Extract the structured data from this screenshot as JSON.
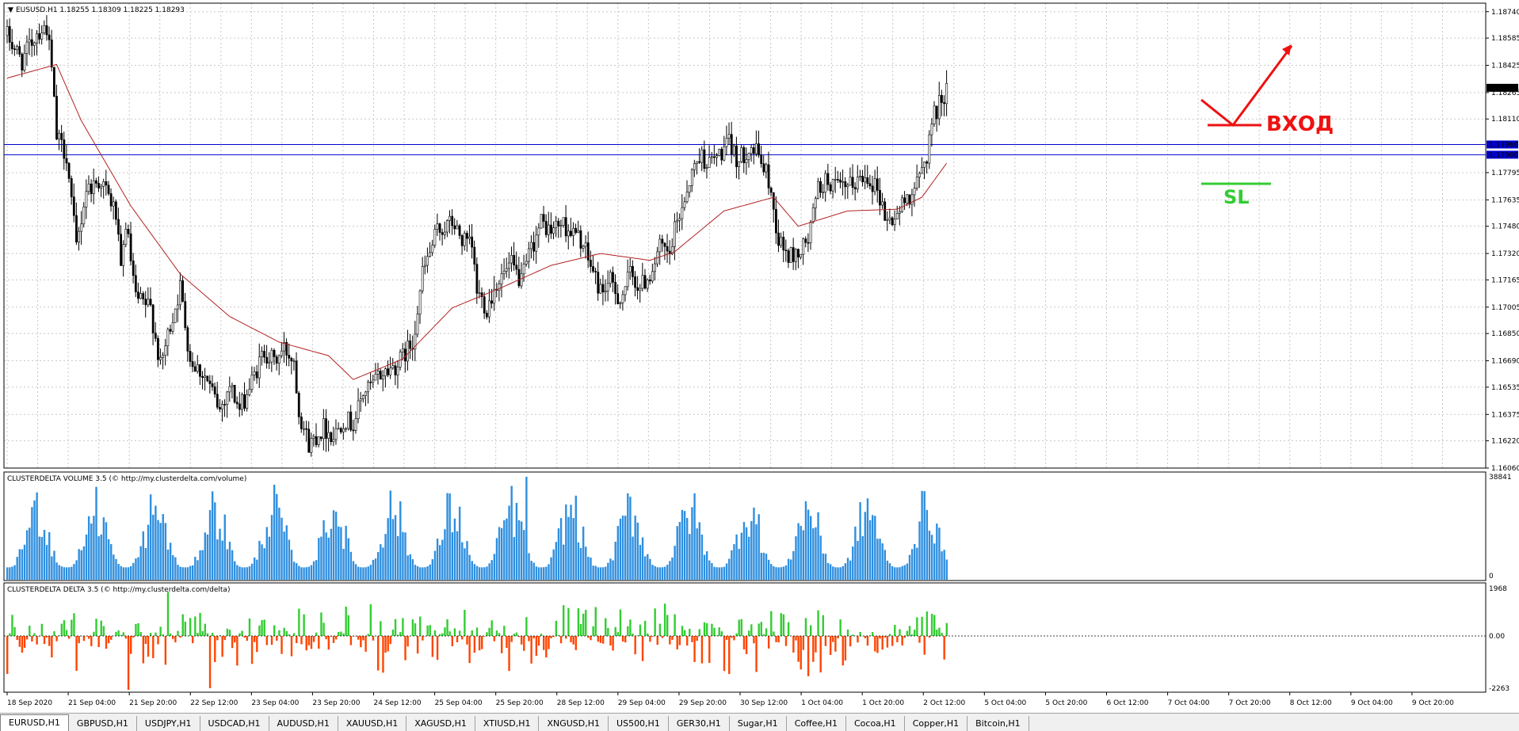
{
  "colors": {
    "candle": "#000000",
    "ma": "#b22222",
    "hline": "#0000cd",
    "volume_bar": "#2f8fdf",
    "delta_positive": "#32cd32",
    "delta_negative": "#ff4500",
    "annotation_red": "#ee1111",
    "annotation_green": "#33cc33",
    "grid": "#c8c8c8",
    "price_tag_bg": "#000000"
  },
  "main_panel": {
    "title": "EUSUSD.H1  1.18255 1.18309 1.18225 1.18293",
    "collapse_icon": "triangle-down-icon",
    "price_ticks": [
      "1.18740",
      "1.18585",
      "1.18425",
      "1.18265",
      "1.18110",
      "1.17795",
      "1.17635",
      "1.17480",
      "1.17320",
      "1.17165",
      "1.17005",
      "1.16850",
      "1.16690",
      "1.16535",
      "1.16375",
      "1.16220",
      "1.16060"
    ],
    "current_price": "1.18293",
    "levels": [
      "1.17960",
      "1.17900"
    ],
    "annotations": {
      "entry": "ВХОД",
      "stop": "SL"
    }
  },
  "volume_panel": {
    "title": "CLUSTERDELTA VOLUME 3.5 (© http://my.clusterdelta.com/volume)",
    "ticks": [
      "38841",
      "0"
    ]
  },
  "delta_panel": {
    "title": "CLUSTERDELTA DELTA 3.5 (© http://my.clusterdelta.com/delta)",
    "ticks": [
      "1968",
      "0.00",
      "-2263"
    ]
  },
  "time_axis": [
    "18 Sep 2020",
    "21 Sep 04:00",
    "21 Sep 20:00",
    "22 Sep 12:00",
    "23 Sep 04:00",
    "23 Sep 20:00",
    "24 Sep 12:00",
    "25 Sep 04:00",
    "25 Sep 20:00",
    "28 Sep 12:00",
    "29 Sep 04:00",
    "29 Sep 20:00",
    "30 Sep 12:00",
    "1 Oct 04:00",
    "1 Oct 20:00",
    "2 Oct 12:00",
    "5 Oct 04:00",
    "5 Oct 20:00",
    "6 Oct 12:00",
    "7 Oct 04:00",
    "7 Oct 20:00",
    "8 Oct 12:00",
    "9 Oct 04:00",
    "9 Oct 20:00"
  ],
  "tabs": [
    "EURUSD,H1",
    "GBPUSD,H1",
    "USDJPY,H1",
    "USDCAD,H1",
    "AUDUSD,H1",
    "XAUUSD,H1",
    "XAGUSD,H1",
    "XTIUSD,H1",
    "XNGUSD,H1",
    "US500,H1",
    "GER30,H1",
    "Sugar,H1",
    "Coffee,H1",
    "Cocoa,H1",
    "Copper,H1",
    "Bitcoin,H1"
  ],
  "chart_data": {
    "type": "candlestick",
    "symbol": "EURUSD",
    "timeframe": "H1",
    "ylim": [
      1.1606,
      1.1879
    ],
    "close_path_anchors": [
      [
        0,
        1.186
      ],
      [
        6,
        1.1845
      ],
      [
        12,
        1.1862
      ],
      [
        16,
        1.1865
      ],
      [
        18,
        1.184
      ],
      [
        20,
        1.18
      ],
      [
        24,
        1.179
      ],
      [
        28,
        1.1735
      ],
      [
        32,
        1.177
      ],
      [
        38,
        1.1775
      ],
      [
        42,
        1.1762
      ],
      [
        44,
        1.1755
      ],
      [
        46,
        1.172
      ],
      [
        48,
        1.175
      ],
      [
        52,
        1.1705
      ],
      [
        58,
        1.17
      ],
      [
        62,
        1.1665
      ],
      [
        66,
        1.169
      ],
      [
        70,
        1.1712
      ],
      [
        74,
        1.167
      ],
      [
        80,
        1.166
      ],
      [
        86,
        1.164
      ],
      [
        90,
        1.1655
      ],
      [
        94,
        1.164
      ],
      [
        100,
        1.166
      ],
      [
        104,
        1.1675
      ],
      [
        108,
        1.1668
      ],
      [
        112,
        1.1676
      ],
      [
        116,
        1.167
      ],
      [
        118,
        1.164
      ],
      [
        122,
        1.162
      ],
      [
        128,
        1.163
      ],
      [
        132,
        1.1625
      ],
      [
        136,
        1.1635
      ],
      [
        140,
        1.1632
      ],
      [
        144,
        1.165
      ],
      [
        148,
        1.1655
      ],
      [
        150,
        1.166
      ],
      [
        158,
        1.1667
      ],
      [
        164,
        1.168
      ],
      [
        168,
        1.172
      ],
      [
        174,
        1.1745
      ],
      [
        180,
        1.175
      ],
      [
        184,
        1.174
      ],
      [
        188,
        1.1735
      ],
      [
        190,
        1.171
      ],
      [
        194,
        1.17
      ],
      [
        198,
        1.1715
      ],
      [
        204,
        1.1725
      ],
      [
        208,
        1.1715
      ],
      [
        212,
        1.1735
      ],
      [
        216,
        1.175
      ],
      [
        220,
        1.1745
      ],
      [
        224,
        1.175
      ],
      [
        228,
        1.1745
      ],
      [
        232,
        1.174
      ],
      [
        236,
        1.1725
      ],
      [
        240,
        1.171
      ],
      [
        244,
        1.1715
      ],
      [
        248,
        1.1705
      ],
      [
        252,
        1.172
      ],
      [
        256,
        1.1712
      ],
      [
        260,
        1.172
      ],
      [
        264,
        1.1735
      ],
      [
        268,
        1.173
      ],
      [
        270,
        1.1745
      ],
      [
        276,
        1.1775
      ],
      [
        280,
        1.179
      ],
      [
        284,
        1.1785
      ],
      [
        288,
        1.179
      ],
      [
        292,
        1.1796
      ],
      [
        296,
        1.1786
      ],
      [
        300,
        1.1795
      ],
      [
        304,
        1.179
      ],
      [
        308,
        1.1775
      ],
      [
        312,
        1.174
      ],
      [
        316,
        1.173
      ],
      [
        320,
        1.1732
      ],
      [
        324,
        1.174
      ],
      [
        328,
        1.177
      ],
      [
        332,
        1.1775
      ],
      [
        336,
        1.177
      ],
      [
        340,
        1.177
      ],
      [
        344,
        1.1775
      ],
      [
        348,
        1.1778
      ],
      [
        352,
        1.177
      ],
      [
        356,
        1.175
      ],
      [
        360,
        1.1755
      ],
      [
        364,
        1.1765
      ],
      [
        368,
        1.1772
      ],
      [
        372,
        1.179
      ],
      [
        374,
        1.181
      ],
      [
        378,
        1.1823
      ],
      [
        380,
        1.1829
      ]
    ],
    "moving_average_anchors": [
      [
        0,
        1.1835
      ],
      [
        20,
        1.1843
      ],
      [
        30,
        1.181
      ],
      [
        50,
        1.176
      ],
      [
        70,
        1.172
      ],
      [
        90,
        1.1695
      ],
      [
        110,
        1.168
      ],
      [
        130,
        1.1672
      ],
      [
        140,
        1.1658
      ],
      [
        160,
        1.167
      ],
      [
        180,
        1.17
      ],
      [
        200,
        1.1712
      ],
      [
        220,
        1.1725
      ],
      [
        240,
        1.1732
      ],
      [
        260,
        1.1728
      ],
      [
        270,
        1.1733
      ],
      [
        290,
        1.1757
      ],
      [
        310,
        1.1765
      ],
      [
        320,
        1.1748
      ],
      [
        340,
        1.1757
      ],
      [
        360,
        1.1758
      ],
      [
        370,
        1.1765
      ],
      [
        380,
        1.1785
      ]
    ],
    "horizontal_levels": [
      1.1796,
      1.179
    ],
    "volume_max": 38841,
    "delta_range": [
      -2263,
      1968
    ]
  }
}
